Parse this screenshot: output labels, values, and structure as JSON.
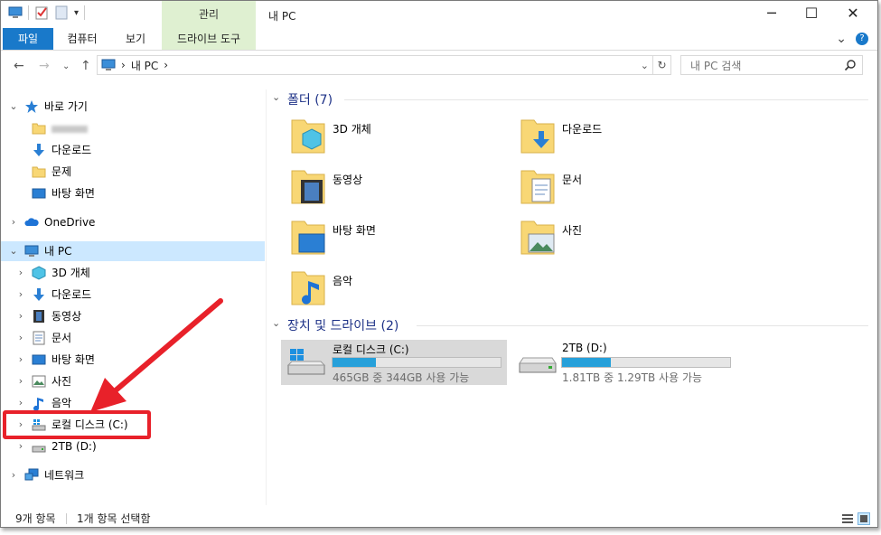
{
  "titlebar": {
    "context_tab": "관리",
    "window_title": "내 PC",
    "minimize": "─",
    "maximize": "☐",
    "close": "✕"
  },
  "ribbon": {
    "tabs": [
      "파일",
      "컴퓨터",
      "보기",
      "드라이브 도구"
    ],
    "expand_glyph": "⌄",
    "help_glyph": "?"
  },
  "address": {
    "crumb_sep": "›",
    "location": "내 PC",
    "trail_sep": "›",
    "search_placeholder": "내 PC 검색"
  },
  "nav": {
    "quick_access": "바로 가기",
    "quick_items": [
      "",
      "다운로드",
      "문제",
      "바탕 화면"
    ],
    "onedrive": "OneDrive",
    "this_pc": "내 PC",
    "pc_items": [
      "3D 개체",
      "다운로드",
      "동영상",
      "문서",
      "바탕 화면",
      "사진",
      "음악",
      "로컬 디스크 (C:)",
      "2TB (D:)"
    ],
    "network": "네트워크"
  },
  "content": {
    "folders_header": "폴더 (7)",
    "folders": [
      "3D 개체",
      "다운로드",
      "동영상",
      "문서",
      "바탕 화면",
      "사진",
      "음악"
    ],
    "drives_header": "장치 및 드라이브 (2)",
    "drives": [
      {
        "name": "로컬 디스크 (C:)",
        "info": "465GB 중 344GB 사용 가능",
        "used_fraction": 0.26
      },
      {
        "name": "2TB (D:)",
        "info": "1.81TB 중 1.29TB 사용 가능",
        "used_fraction": 0.29
      }
    ]
  },
  "status": {
    "item_count": "9개 항목",
    "selected": "1개 항목 선택함"
  },
  "colors": {
    "accent": "#1979ca",
    "selection": "#cce8ff",
    "context_tab": "#dff0d1",
    "usage_bar": "#26a0da",
    "annotation": "#e8212a"
  }
}
